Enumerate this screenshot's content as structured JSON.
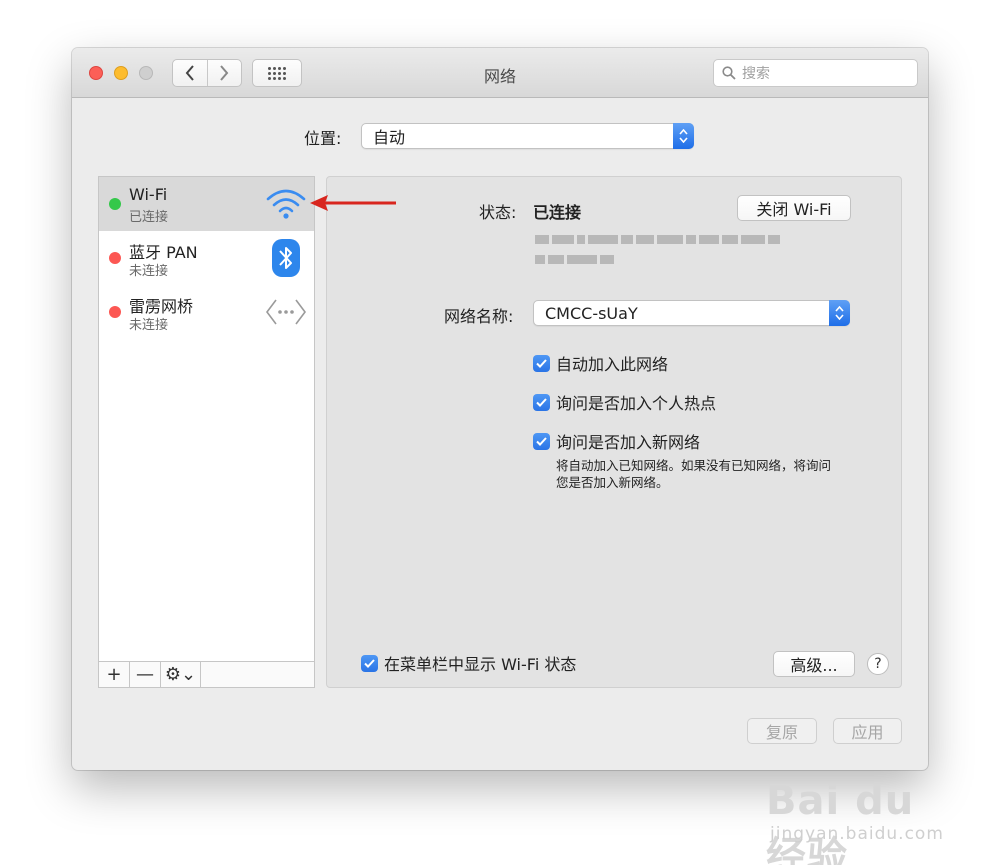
{
  "window": {
    "title": "网络"
  },
  "toolbar": {
    "back_icon": "chevron-left-icon",
    "forward_icon": "chevron-right-icon",
    "grid_icon": "grid-icon"
  },
  "search": {
    "placeholder": "搜索"
  },
  "location": {
    "label": "位置:",
    "value": "自动"
  },
  "services": [
    {
      "name": "Wi-Fi",
      "status": "已连接",
      "status_color": "#34c84a",
      "icon": "wifi-icon",
      "selected": true
    },
    {
      "name": "蓝牙 PAN",
      "status": "未连接",
      "status_color": "#fc5753",
      "icon": "bluetooth-icon",
      "selected": false
    },
    {
      "name": "雷雳网桥",
      "status": "未连接",
      "status_color": "#fc5753",
      "icon": "thunderbolt-bridge-icon",
      "selected": false
    }
  ],
  "sidebar_footer": {
    "add": "+",
    "remove": "—",
    "gear": "⚙⌄"
  },
  "detail": {
    "status_label": "状态:",
    "status_value": "已连接",
    "turn_off_button": "关闭 Wi-Fi",
    "network_name_label": "网络名称:",
    "network_name_value": "CMCC-sUaY",
    "checkboxes": [
      {
        "label": "自动加入此网络",
        "checked": true
      },
      {
        "label": "询问是否加入个人热点",
        "checked": true
      },
      {
        "label": "询问是否加入新网络",
        "checked": true
      }
    ],
    "note_line1": "将自动加入已知网络。如果没有已知网络，将询问",
    "note_line2": "您是否加入新网络。",
    "show_in_menubar": {
      "label": "在菜单栏中显示 Wi-Fi 状态",
      "checked": true
    },
    "advanced_button": "高级...",
    "help_button": "?"
  },
  "footer": {
    "revert_button": "复原",
    "apply_button": "应用"
  },
  "annotation": {
    "arrow_color": "#d8261e"
  },
  "watermark": {
    "main": "Bai du 经验",
    "sub": "jingyan.baidu.com"
  }
}
